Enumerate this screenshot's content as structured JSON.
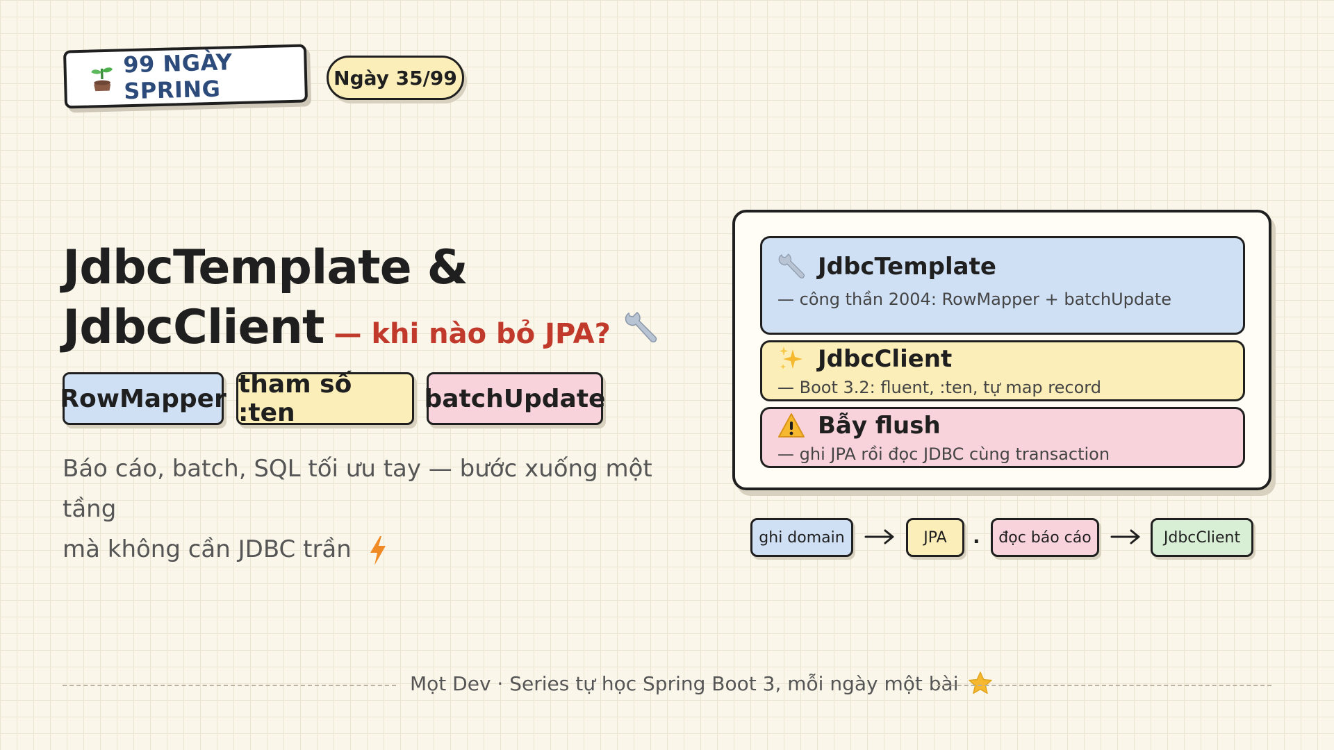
{
  "header": {
    "brand_label": "99 NGÀY SPRING",
    "brand_icon": "sprout-icon",
    "day_label": "Ngày 35/99"
  },
  "title": {
    "line1": "JdbcTemplate &",
    "line2": "JdbcClient",
    "subtitle": "— khi nào bỏ JPA?",
    "icon": "wrench-icon"
  },
  "tags": [
    {
      "label": "RowMapper",
      "color": "#cfe0f5"
    },
    {
      "label": "tham số :ten",
      "color": "#fbeeb8"
    },
    {
      "label": "batchUpdate",
      "color": "#f8d3dc"
    }
  ],
  "description": {
    "line1": "Báo cáo, batch, SQL tối ưu tay — bước xuống một tầng",
    "line2": "mà không cần JDBC trần",
    "icon": "lightning-icon"
  },
  "card": {
    "rows": [
      {
        "icon": "wrench-icon",
        "name": "JdbcTemplate",
        "desc": "— công thần 2004: RowMapper + batchUpdate",
        "color": "#cfe0f5"
      },
      {
        "icon": "sparkles-icon",
        "name": "JdbcClient",
        "desc": "— Boot 3.2: fluent, :ten, tự map record",
        "color": "#fbeeb8"
      },
      {
        "icon": "warning-icon",
        "name": "Bẫy flush",
        "desc": "— ghi JPA rồi đọc JDBC cùng transaction",
        "color": "#f8d3dc"
      }
    ]
  },
  "flow": {
    "chips": [
      "ghi domain",
      "JPA",
      "đọc báo cáo",
      "JdbcClient"
    ],
    "separator": "."
  },
  "footer": {
    "text": "Mọt Dev · Series tự học Spring Boot 3, mỗi ngày một bài",
    "icon": "star-icon"
  },
  "colors": {
    "background": "#faf6ea",
    "accent_red": "#c0392b",
    "brand_blue": "#2c4a7a"
  }
}
